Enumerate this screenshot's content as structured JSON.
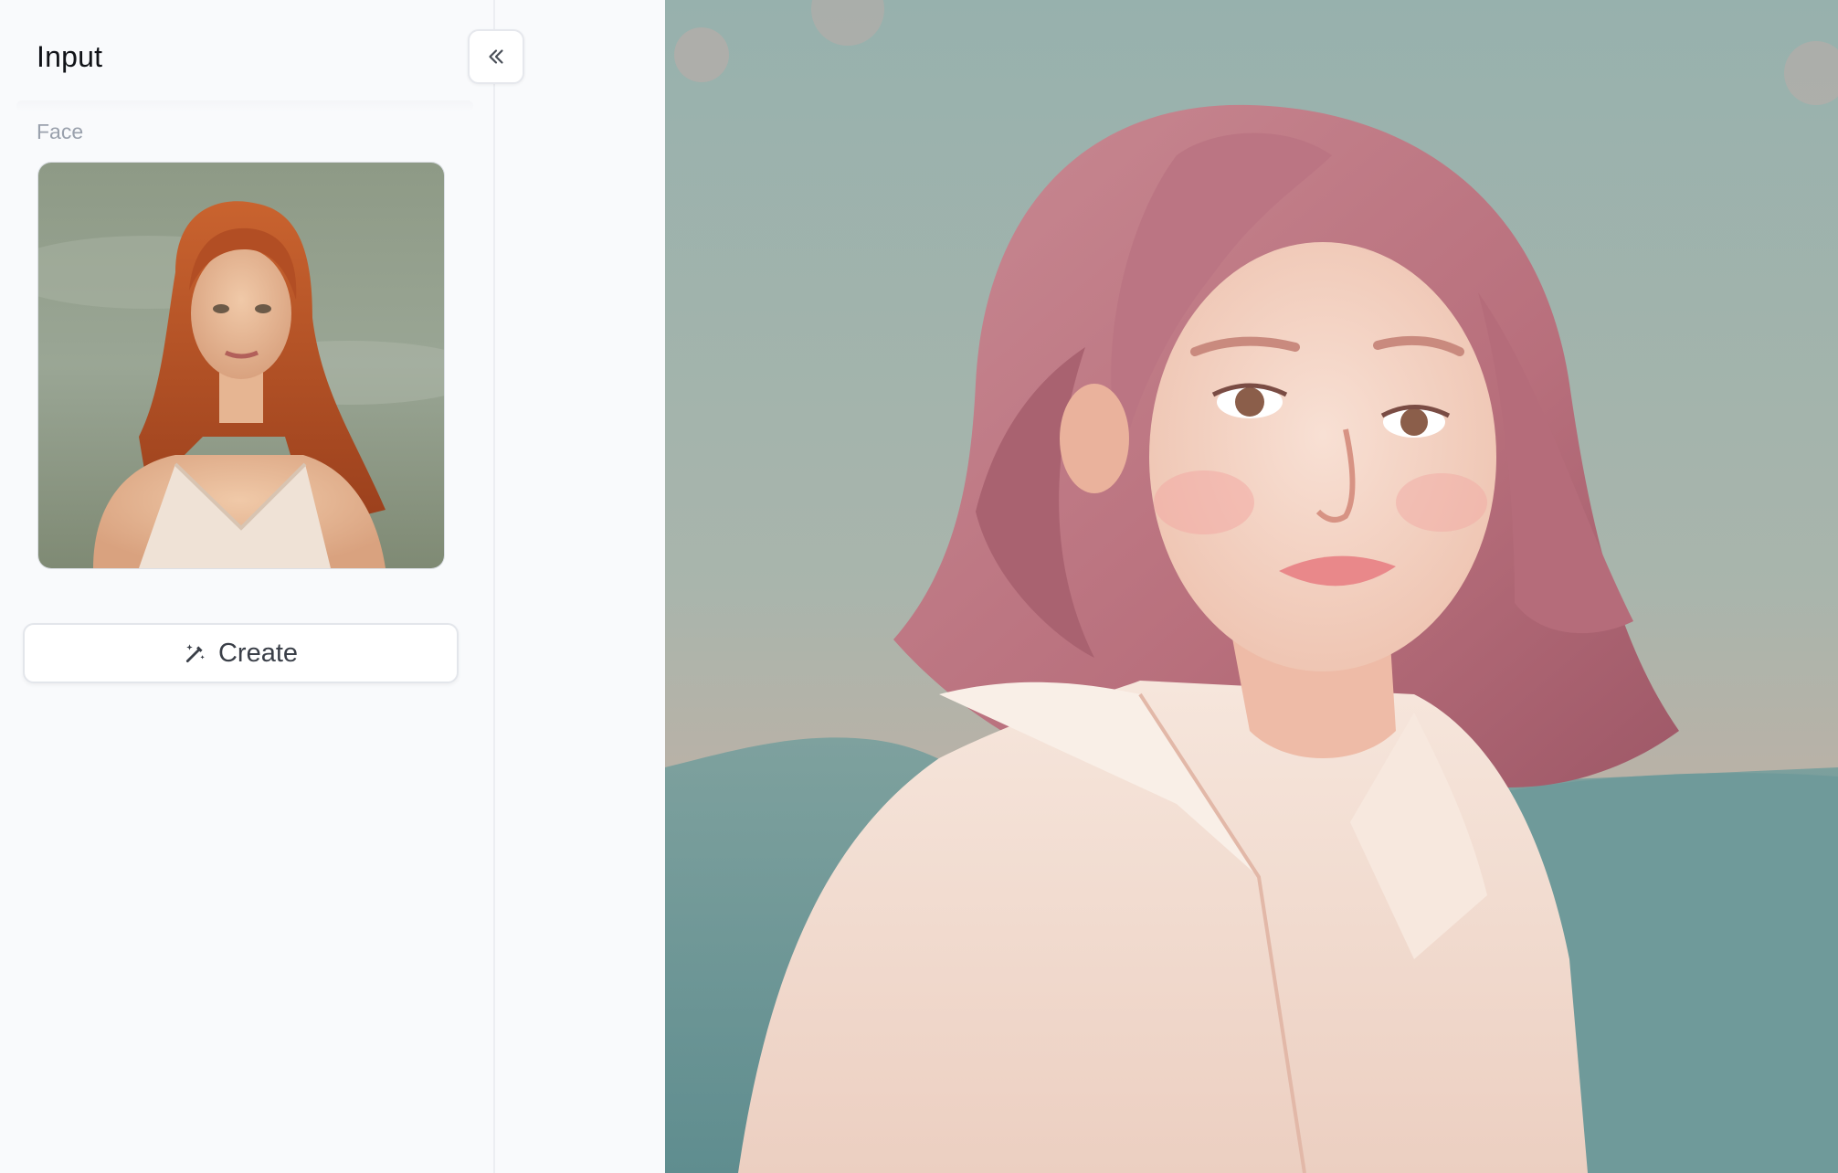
{
  "sidebar": {
    "title": "Input",
    "section_label": "Face",
    "collapse_icon": "chevrons-left-icon",
    "face_image": {
      "icon": "portrait-photo",
      "description_colors": {
        "hair": "#b9552a",
        "background": "#8c9a8c"
      }
    }
  },
  "actions": {
    "create_label": "Create",
    "create_icon": "magic-wand-icon"
  },
  "result_image": {
    "icon": "stylized-portrait",
    "colors": {
      "sky": "#9fb4b0",
      "hair": "#c77f8c",
      "shirt": "#f3ddd0",
      "hills": "#6f9a9a"
    }
  },
  "theme": {
    "panel_bg": "#f9fafc",
    "text_primary": "#111318",
    "text_muted": "#9aa1ad"
  }
}
